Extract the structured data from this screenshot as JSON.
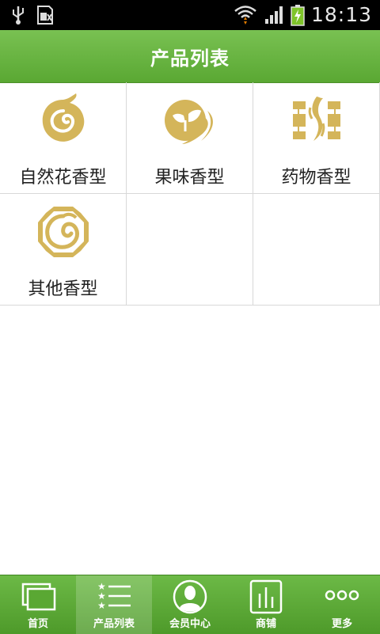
{
  "status": {
    "time": "18:13",
    "icons": [
      "usb-icon",
      "sim-icon",
      "wifi-icon",
      "signal-icon",
      "battery-charging-icon"
    ]
  },
  "header": {
    "title": "产品列表"
  },
  "colors": {
    "accent": "#5aa833",
    "icon_gold": "#d4b55a"
  },
  "products": [
    {
      "label": "自然花香型",
      "icon": "swirl-flame-icon"
    },
    {
      "label": "果味香型",
      "icon": "leaf-circle-icon"
    },
    {
      "label": "药物香型",
      "icon": "meander-pattern-icon"
    },
    {
      "label": "其他香型",
      "icon": "octagon-swirl-icon"
    }
  ],
  "tabs": [
    {
      "label": "首页",
      "icon": "home-windows-icon",
      "active": false
    },
    {
      "label": "产品列表",
      "icon": "star-list-icon",
      "active": true
    },
    {
      "label": "会员中心",
      "icon": "member-avatar-icon",
      "active": false
    },
    {
      "label": "商铺",
      "icon": "bar-chart-icon",
      "active": false
    },
    {
      "label": "更多",
      "icon": "more-dots-icon",
      "active": false
    }
  ]
}
